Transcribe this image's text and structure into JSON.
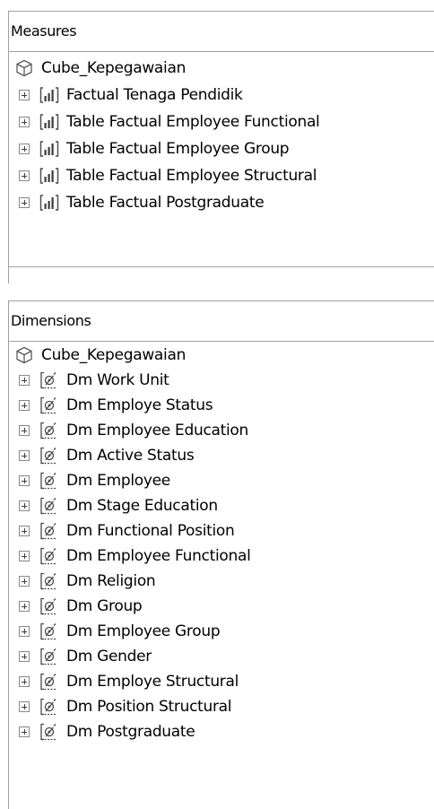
{
  "measures": {
    "header": "Measures",
    "root": {
      "label": "Cube_Kepegawaian",
      "icon": "cube-icon"
    },
    "items": [
      {
        "label": "Factual Tenaga Pendidik",
        "icon": "measure-group-icon"
      },
      {
        "label": "Table Factual Employee Functional",
        "icon": "measure-group-icon"
      },
      {
        "label": "Table Factual Employee Group",
        "icon": "measure-group-icon"
      },
      {
        "label": "Table Factual Employee Structural",
        "icon": "measure-group-icon"
      },
      {
        "label": "Table Factual Postgraduate",
        "icon": "measure-group-icon"
      }
    ]
  },
  "dimensions": {
    "header": "Dimensions",
    "root": {
      "label": "Cube_Kepegawaian",
      "icon": "cube-icon"
    },
    "items": [
      {
        "label": "Dm Work Unit",
        "icon": "dimension-icon"
      },
      {
        "label": "Dm Employe Status",
        "icon": "dimension-icon"
      },
      {
        "label": "Dm Employee Education",
        "icon": "dimension-icon"
      },
      {
        "label": "Dm Active Status",
        "icon": "dimension-icon"
      },
      {
        "label": "Dm Employee",
        "icon": "dimension-icon"
      },
      {
        "label": "Dm Stage Education",
        "icon": "dimension-icon"
      },
      {
        "label": "Dm Functional Position",
        "icon": "dimension-icon"
      },
      {
        "label": "Dm Employee Functional",
        "icon": "dimension-icon"
      },
      {
        "label": "Dm Religion",
        "icon": "dimension-icon"
      },
      {
        "label": "Dm Group",
        "icon": "dimension-icon"
      },
      {
        "label": "Dm Employee Group",
        "icon": "dimension-icon"
      },
      {
        "label": "Dm Gender",
        "icon": "dimension-icon"
      },
      {
        "label": "Dm Employe Structural",
        "icon": "dimension-icon"
      },
      {
        "label": "Dm Position Structural",
        "icon": "dimension-icon"
      },
      {
        "label": "Dm Postgraduate",
        "icon": "dimension-icon"
      }
    ]
  },
  "colors": {
    "border": "#a0a0a0",
    "expander_border": "#8a8a8a",
    "icon_stroke": "#4a4a4a",
    "background": "#ffffff"
  }
}
